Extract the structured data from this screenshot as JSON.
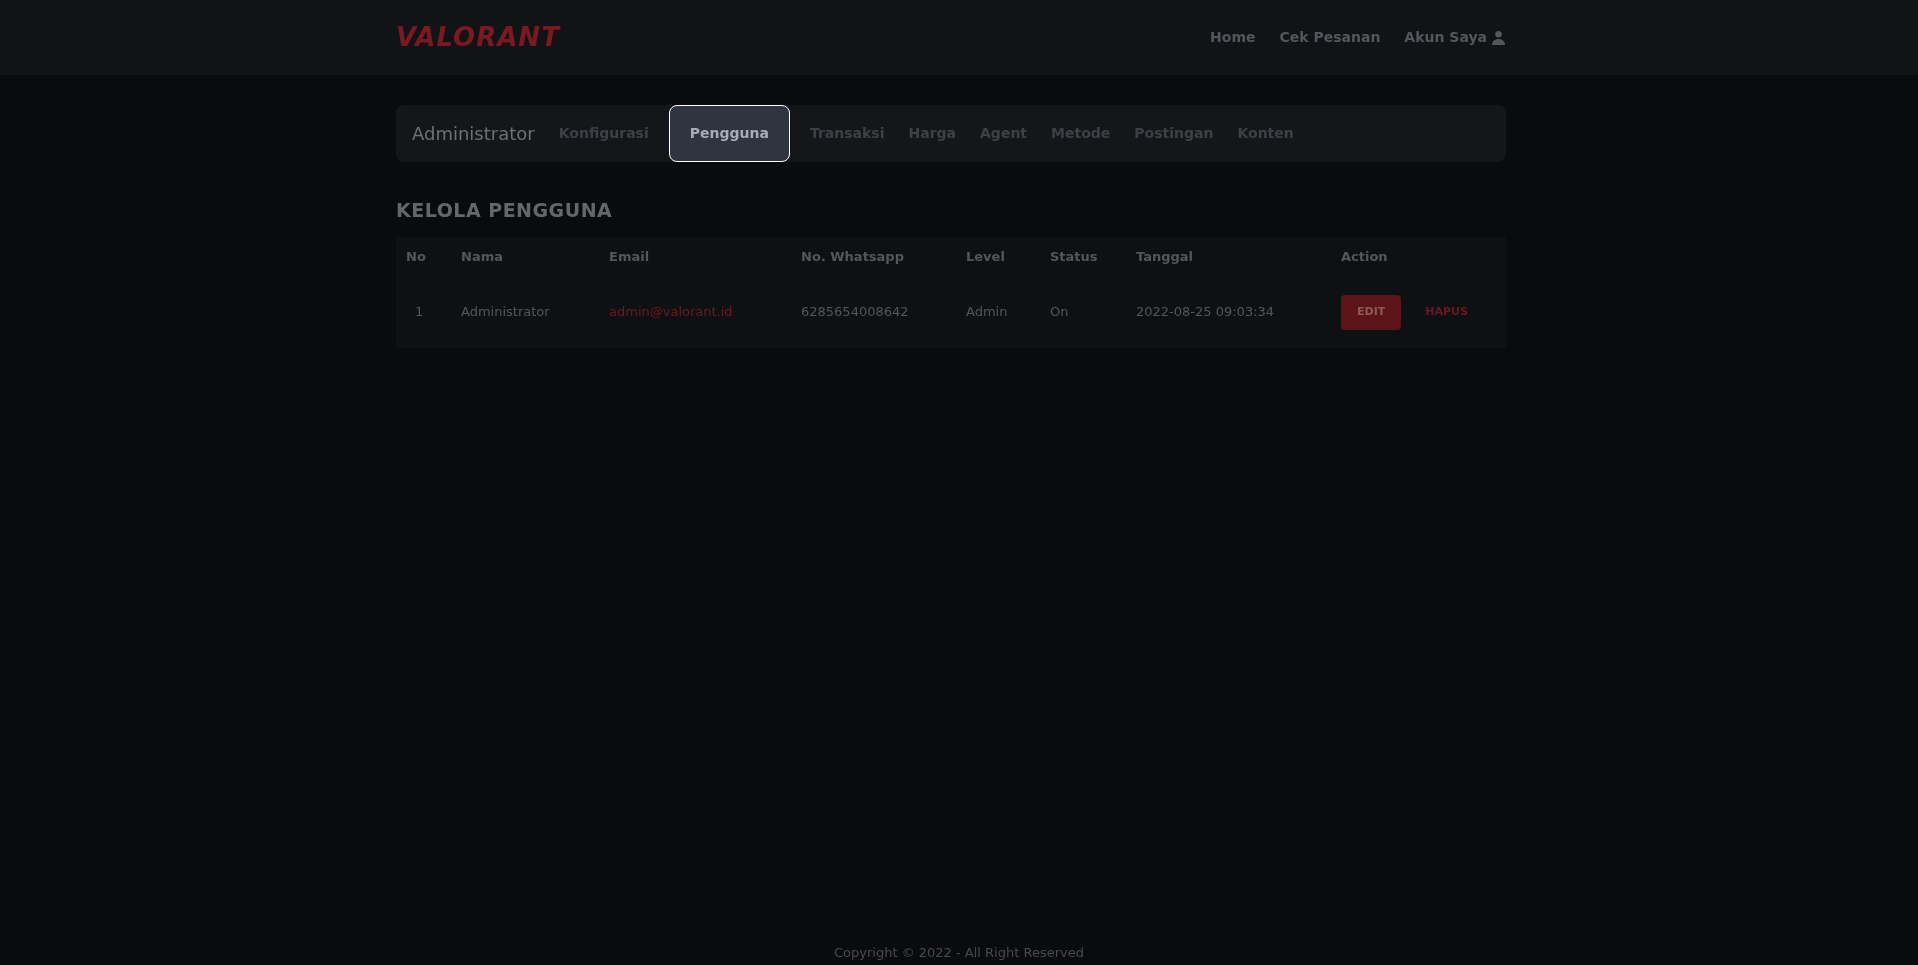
{
  "navbar": {
    "logo": "VALORANT",
    "links": [
      {
        "label": "Home"
      },
      {
        "label": "Cek Pesanan"
      },
      {
        "label": "Akun Saya"
      }
    ]
  },
  "admin_bar": {
    "title": "Administrator",
    "tabs": [
      {
        "label": "Konfigurasi",
        "selected": false
      },
      {
        "label": "Pengguna",
        "selected": true
      },
      {
        "label": "Transaksi",
        "selected": false
      },
      {
        "label": "Harga",
        "selected": false
      },
      {
        "label": "Agent",
        "selected": false
      },
      {
        "label": "Metode",
        "selected": false
      },
      {
        "label": "Postingan",
        "selected": false
      },
      {
        "label": "Konten",
        "selected": false
      }
    ]
  },
  "heading": "KELOLA PENGGUNA",
  "table": {
    "columns": [
      "No",
      "Nama",
      "Email",
      "No. Whatsapp",
      "Level",
      "Status",
      "Tanggal",
      "Action"
    ],
    "rows": [
      {
        "no": "1",
        "nama": "Administrator",
        "email": "admin@valorant.id",
        "whatsapp": "6285654008642",
        "level_text": "Admin",
        "status": "On",
        "tanggal": "2022-08-25 09:03:34",
        "actions": [
          {
            "label": "EDIT",
            "kind": "primary"
          },
          {
            "label": "HAPUS",
            "kind": "link"
          }
        ]
      }
    ]
  },
  "footer": "Copyright © 2022 - All Right Reserved"
}
